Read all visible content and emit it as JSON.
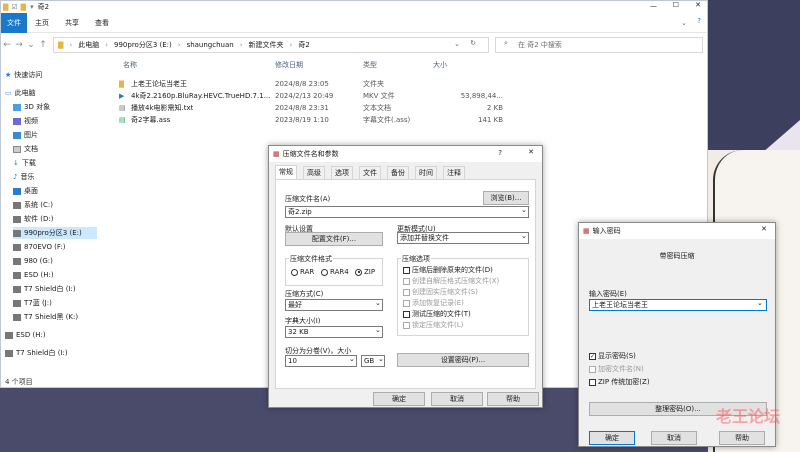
{
  "explorer": {
    "title": "奇2",
    "ribbon_tabs": [
      "文件",
      "主页",
      "共享",
      "查看"
    ],
    "path": [
      "此电脑",
      "990pro分区3 (E:)",
      "shaungchuan",
      "新建文件夹",
      "奇2"
    ],
    "search_placeholder": "在 奇2 中搜索",
    "columns": [
      "名称",
      "修改日期",
      "类型",
      "大小"
    ],
    "sidebar": [
      "快速访问",
      "此电脑",
      "3D 对象",
      "视频",
      "图片",
      "文档",
      "下载",
      "音乐",
      "桌面",
      "系统 (C:)",
      "软件 (D:)",
      "990pro分区3 (E:)",
      "870EVO (F:)",
      "980 (G:)",
      "ESD (H:)",
      "T7 Shield白 (I:)",
      "T7蓝 (J:)",
      "T7 Shield黑 (K:)",
      "ESD (H:)",
      "T7 Shield白 (I:)"
    ],
    "files": [
      {
        "name": "上老王论坛当老王",
        "date": "2024/8/8 23:05",
        "type": "文件夹",
        "size": ""
      },
      {
        "name": "4k奇2.2160p.BluRay.HEVC.TrueHD.7.1...",
        "date": "2024/2/13 20:49",
        "type": "MKV 文件",
        "size": "53,898,44..."
      },
      {
        "name": "播放4k电影需知.txt",
        "date": "2024/8/8 23:31",
        "type": "文本文档",
        "size": "2 KB"
      },
      {
        "name": "奇2字幕.ass",
        "date": "2023/8/19 1:10",
        "type": "字幕文件(.ass)",
        "size": "141 KB"
      }
    ],
    "status": "4 个项目"
  },
  "archive": {
    "title": "压缩文件名和参数",
    "help": "?",
    "tabs": [
      "常规",
      "高级",
      "选项",
      "文件",
      "备份",
      "时间",
      "注释"
    ],
    "filename_label": "压缩文件名(A)",
    "filename": "奇2.zip",
    "browse": "浏览(B)...",
    "default_label": "默认设置",
    "config_btn": "配置文件(F)...",
    "update_label": "更新模式(U)",
    "update_value": "添加并替换文件",
    "format_label": "压缩文件格式",
    "formats": [
      "RAR",
      "RAR4",
      "ZIP"
    ],
    "options_label": "压缩选项",
    "options": [
      "压缩后删除原来的文件(D)",
      "创建自解压格式压缩文件(X)",
      "创建固实压缩文件(S)",
      "添加恢复记录(E)",
      "测试压缩的文件(T)",
      "锁定压缩文件(L)"
    ],
    "method_label": "压缩方式(C)",
    "method": "最好",
    "dict_label": "字典大小(I)",
    "dict": "32 KB",
    "split_label": "切分为分卷(V)，大小",
    "split": "10",
    "split_unit": "GB",
    "setpwd": "设置密码(P)...",
    "ok": "确定",
    "cancel": "取消",
    "help_btn": "帮助"
  },
  "password": {
    "title": "输入密码",
    "heading": "带密码压缩",
    "enter_label": "输入密码(E)",
    "value": "上老王论坛当老王",
    "show": "显示密码(S)",
    "encrypt_names": "加密文件名(N)",
    "zip_legacy": "ZIP 传统加密(Z)",
    "organize": "整理密码(O)...",
    "ok": "确定",
    "cancel": "取消",
    "help": "帮助"
  },
  "watermark": "老王论坛"
}
